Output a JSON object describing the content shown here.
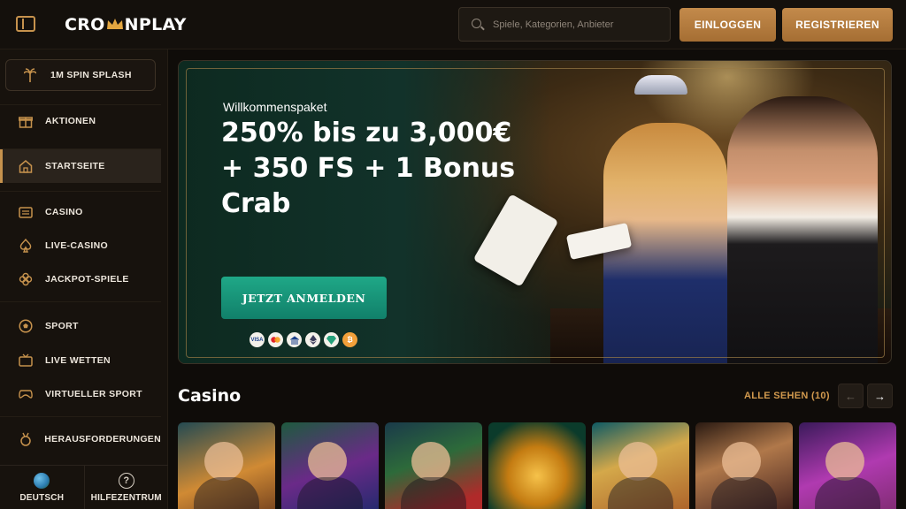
{
  "header": {
    "logo_text_left": "CRO",
    "logo_text_right": "NPLAY",
    "search_placeholder": "Spiele, Kategorien, Anbieter",
    "login_label": "EINLOGGEN",
    "register_label": "REGISTRIEREN",
    "accent_color": "#c38a4b"
  },
  "sidebar": {
    "promo_label": "1M SPIN SPLASH",
    "promo_icon": "palm-tree-icon",
    "items": [
      {
        "label": "AKTIONEN",
        "icon": "gift-icon"
      },
      {
        "label": "STARTSEITE",
        "icon": "home-icon",
        "active": true
      },
      {
        "label": "CASINO",
        "icon": "slot-machine-icon"
      },
      {
        "label": "LIVE-CASINO",
        "icon": "spade-icon"
      },
      {
        "label": "JACKPOT-SPIELE",
        "icon": "clover-icon"
      },
      {
        "label": "SPORT",
        "icon": "soccer-ball-icon"
      },
      {
        "label": "LIVE WETTEN",
        "icon": "live-tv-icon"
      },
      {
        "label": "VIRTUELLER SPORT",
        "icon": "gamepad-icon"
      },
      {
        "label": "HERAUSFORDERUNGEN",
        "icon": "medal-icon"
      }
    ],
    "footer": {
      "language_label": "DEUTSCH",
      "help_label": "HILFEZENTRUM"
    }
  },
  "hero": {
    "kicker": "Willkommenspaket",
    "headline": "250% bis zu 3,000€ + 350 FS + 1 Bonus Crab",
    "cta_label": "JETZT ANMELDEN",
    "payment_icons": [
      "visa-icon",
      "mastercard-icon",
      "bank-icon",
      "ethereum-icon",
      "tether-icon",
      "bitcoin-icon"
    ],
    "payment_labels": [
      "VISA",
      "",
      "",
      "",
      "",
      "₿"
    ]
  },
  "casino": {
    "title": "Casino",
    "see_all_label": "ALLE SEHEN (10)",
    "prev_label": "←",
    "next_label": "→",
    "tiles": [
      "game-tile-viking",
      "game-tile-magician",
      "game-tile-pirates",
      "game-tile-diamond",
      "game-tile-aztec",
      "game-tile-poker",
      "game-tile-crazy"
    ]
  }
}
